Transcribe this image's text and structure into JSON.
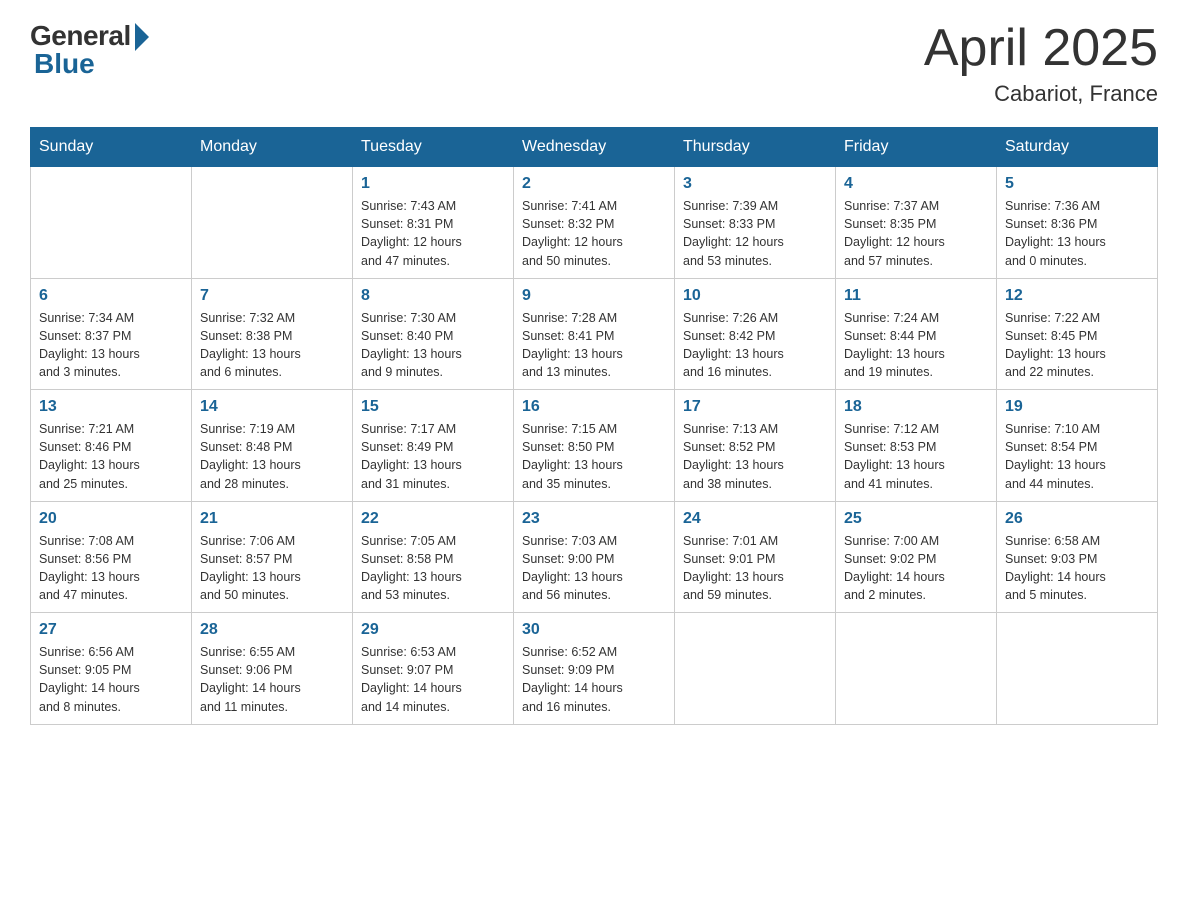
{
  "header": {
    "logo_general": "General",
    "logo_blue": "Blue",
    "month_title": "April 2025",
    "location": "Cabariot, France"
  },
  "days_of_week": [
    "Sunday",
    "Monday",
    "Tuesday",
    "Wednesday",
    "Thursday",
    "Friday",
    "Saturday"
  ],
  "weeks": [
    [
      {
        "day": "",
        "info": ""
      },
      {
        "day": "",
        "info": ""
      },
      {
        "day": "1",
        "info": "Sunrise: 7:43 AM\nSunset: 8:31 PM\nDaylight: 12 hours\nand 47 minutes."
      },
      {
        "day": "2",
        "info": "Sunrise: 7:41 AM\nSunset: 8:32 PM\nDaylight: 12 hours\nand 50 minutes."
      },
      {
        "day": "3",
        "info": "Sunrise: 7:39 AM\nSunset: 8:33 PM\nDaylight: 12 hours\nand 53 minutes."
      },
      {
        "day": "4",
        "info": "Sunrise: 7:37 AM\nSunset: 8:35 PM\nDaylight: 12 hours\nand 57 minutes."
      },
      {
        "day": "5",
        "info": "Sunrise: 7:36 AM\nSunset: 8:36 PM\nDaylight: 13 hours\nand 0 minutes."
      }
    ],
    [
      {
        "day": "6",
        "info": "Sunrise: 7:34 AM\nSunset: 8:37 PM\nDaylight: 13 hours\nand 3 minutes."
      },
      {
        "day": "7",
        "info": "Sunrise: 7:32 AM\nSunset: 8:38 PM\nDaylight: 13 hours\nand 6 minutes."
      },
      {
        "day": "8",
        "info": "Sunrise: 7:30 AM\nSunset: 8:40 PM\nDaylight: 13 hours\nand 9 minutes."
      },
      {
        "day": "9",
        "info": "Sunrise: 7:28 AM\nSunset: 8:41 PM\nDaylight: 13 hours\nand 13 minutes."
      },
      {
        "day": "10",
        "info": "Sunrise: 7:26 AM\nSunset: 8:42 PM\nDaylight: 13 hours\nand 16 minutes."
      },
      {
        "day": "11",
        "info": "Sunrise: 7:24 AM\nSunset: 8:44 PM\nDaylight: 13 hours\nand 19 minutes."
      },
      {
        "day": "12",
        "info": "Sunrise: 7:22 AM\nSunset: 8:45 PM\nDaylight: 13 hours\nand 22 minutes."
      }
    ],
    [
      {
        "day": "13",
        "info": "Sunrise: 7:21 AM\nSunset: 8:46 PM\nDaylight: 13 hours\nand 25 minutes."
      },
      {
        "day": "14",
        "info": "Sunrise: 7:19 AM\nSunset: 8:48 PM\nDaylight: 13 hours\nand 28 minutes."
      },
      {
        "day": "15",
        "info": "Sunrise: 7:17 AM\nSunset: 8:49 PM\nDaylight: 13 hours\nand 31 minutes."
      },
      {
        "day": "16",
        "info": "Sunrise: 7:15 AM\nSunset: 8:50 PM\nDaylight: 13 hours\nand 35 minutes."
      },
      {
        "day": "17",
        "info": "Sunrise: 7:13 AM\nSunset: 8:52 PM\nDaylight: 13 hours\nand 38 minutes."
      },
      {
        "day": "18",
        "info": "Sunrise: 7:12 AM\nSunset: 8:53 PM\nDaylight: 13 hours\nand 41 minutes."
      },
      {
        "day": "19",
        "info": "Sunrise: 7:10 AM\nSunset: 8:54 PM\nDaylight: 13 hours\nand 44 minutes."
      }
    ],
    [
      {
        "day": "20",
        "info": "Sunrise: 7:08 AM\nSunset: 8:56 PM\nDaylight: 13 hours\nand 47 minutes."
      },
      {
        "day": "21",
        "info": "Sunrise: 7:06 AM\nSunset: 8:57 PM\nDaylight: 13 hours\nand 50 minutes."
      },
      {
        "day": "22",
        "info": "Sunrise: 7:05 AM\nSunset: 8:58 PM\nDaylight: 13 hours\nand 53 minutes."
      },
      {
        "day": "23",
        "info": "Sunrise: 7:03 AM\nSunset: 9:00 PM\nDaylight: 13 hours\nand 56 minutes."
      },
      {
        "day": "24",
        "info": "Sunrise: 7:01 AM\nSunset: 9:01 PM\nDaylight: 13 hours\nand 59 minutes."
      },
      {
        "day": "25",
        "info": "Sunrise: 7:00 AM\nSunset: 9:02 PM\nDaylight: 14 hours\nand 2 minutes."
      },
      {
        "day": "26",
        "info": "Sunrise: 6:58 AM\nSunset: 9:03 PM\nDaylight: 14 hours\nand 5 minutes."
      }
    ],
    [
      {
        "day": "27",
        "info": "Sunrise: 6:56 AM\nSunset: 9:05 PM\nDaylight: 14 hours\nand 8 minutes."
      },
      {
        "day": "28",
        "info": "Sunrise: 6:55 AM\nSunset: 9:06 PM\nDaylight: 14 hours\nand 11 minutes."
      },
      {
        "day": "29",
        "info": "Sunrise: 6:53 AM\nSunset: 9:07 PM\nDaylight: 14 hours\nand 14 minutes."
      },
      {
        "day": "30",
        "info": "Sunrise: 6:52 AM\nSunset: 9:09 PM\nDaylight: 14 hours\nand 16 minutes."
      },
      {
        "day": "",
        "info": ""
      },
      {
        "day": "",
        "info": ""
      },
      {
        "day": "",
        "info": ""
      }
    ]
  ]
}
